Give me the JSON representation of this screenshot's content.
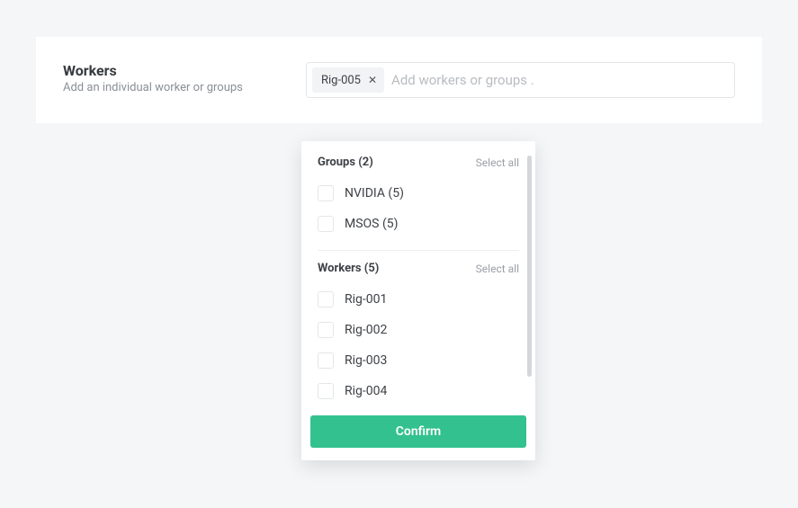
{
  "section": {
    "title": "Workers",
    "subtitle": "Add an individual worker or groups"
  },
  "field": {
    "chip": "Rig-005",
    "placeholder": "Add workers or groups ."
  },
  "dropdown": {
    "groups_header": "Groups (2)",
    "workers_header": "Workers (5)",
    "select_all": "Select all",
    "groups": [
      {
        "label": "NVIDIA (5)"
      },
      {
        "label": "MSOS (5)"
      }
    ],
    "workers": [
      {
        "label": "Rig-001"
      },
      {
        "label": "Rig-002"
      },
      {
        "label": "Rig-003"
      },
      {
        "label": "Rig-004"
      }
    ],
    "confirm": "Confirm"
  }
}
